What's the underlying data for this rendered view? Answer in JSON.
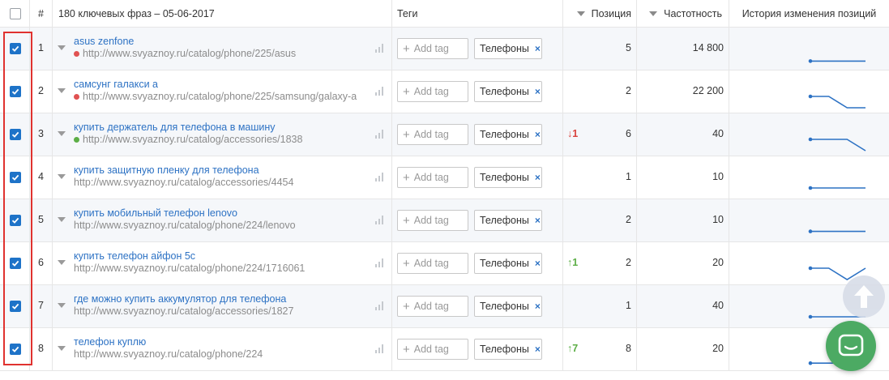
{
  "header": {
    "num_label": "#",
    "keywords_title": "180 ключевых фраз – 05-06-2017",
    "tags_label": "Теги",
    "position_label": "Позиция",
    "frequency_label": "Частотность",
    "history_label": "История изменения позиций"
  },
  "add_tag_placeholder": "Add tag",
  "tag_remove_glyph": "×",
  "rows": [
    {
      "num": "1",
      "keyword": "asus zenfone",
      "url": "http://www.svyaznoy.ru/catalog/phone/225/asus",
      "dot_color": "#e05252",
      "tag": "Телефоны",
      "delta": "",
      "delta_dir": "",
      "position": "5",
      "frequency": "14 800",
      "checked": true,
      "history": [
        5,
        5,
        5,
        5
      ]
    },
    {
      "num": "2",
      "keyword": "самсунг галакси а",
      "url": "http://www.svyaznoy.ru/catalog/phone/225/samsung/galaxy-a",
      "dot_color": "#e05252",
      "tag": "Телефоны",
      "delta": "",
      "delta_dir": "",
      "position": "2",
      "frequency": "22 200",
      "checked": true,
      "history": [
        1,
        1,
        2,
        2
      ]
    },
    {
      "num": "3",
      "keyword": "купить держатель для телефона в машину",
      "url": "http://www.svyaznoy.ru/catalog/accessories/1838",
      "dot_color": "#5cae46",
      "tag": "Телефоны",
      "delta": "↓1",
      "delta_dir": "down",
      "position": "6",
      "frequency": "40",
      "checked": true,
      "history": [
        5,
        5,
        5,
        6
      ]
    },
    {
      "num": "4",
      "keyword": "купить защитную пленку для телефона",
      "url": "http://www.svyaznoy.ru/catalog/accessories/4454",
      "dot_color": "",
      "tag": "Телефоны",
      "delta": "",
      "delta_dir": "",
      "position": "1",
      "frequency": "10",
      "checked": true,
      "history": [
        1,
        1,
        1,
        1
      ]
    },
    {
      "num": "5",
      "keyword": "купить мобильный телефон lenovo",
      "url": "http://www.svyaznoy.ru/catalog/phone/224/lenovo",
      "dot_color": "",
      "tag": "Телефоны",
      "delta": "",
      "delta_dir": "",
      "position": "2",
      "frequency": "10",
      "checked": true,
      "history": [
        2,
        2,
        2,
        2
      ]
    },
    {
      "num": "6",
      "keyword": "купить телефон айфон 5с",
      "url": "http://www.svyaznoy.ru/catalog/phone/224/1716061",
      "dot_color": "",
      "tag": "Телефоны",
      "delta": "↑1",
      "delta_dir": "up",
      "position": "2",
      "frequency": "20",
      "checked": true,
      "history": [
        2,
        2,
        3,
        2
      ]
    },
    {
      "num": "7",
      "keyword": "где можно купить аккумулятор для телефона",
      "url": "http://www.svyaznoy.ru/catalog/accessories/1827",
      "dot_color": "",
      "tag": "Телефоны",
      "delta": "",
      "delta_dir": "",
      "position": "1",
      "frequency": "40",
      "checked": true,
      "history": [
        1,
        1,
        1,
        1
      ]
    },
    {
      "num": "8",
      "keyword": "телефон куплю",
      "url": "http://www.svyaznoy.ru/catalog/phone/224",
      "dot_color": "",
      "tag": "Телефоны",
      "delta": "↑7",
      "delta_dir": "up",
      "position": "8",
      "frequency": "20",
      "checked": true,
      "history": [
        8,
        8,
        8,
        8
      ]
    }
  ],
  "colors": {
    "accent": "#2d72c4",
    "checkbox": "#1e73c8",
    "highlight_frame": "#e0322f",
    "chat_button": "#4caa63",
    "sparkline": "#2d72c4"
  },
  "icons": {
    "sort": "sort-down-icon",
    "expand": "chevron-down-icon",
    "stats": "bar-chart-icon",
    "scroll_top": "arrow-up-icon",
    "chat": "chat-icon"
  }
}
